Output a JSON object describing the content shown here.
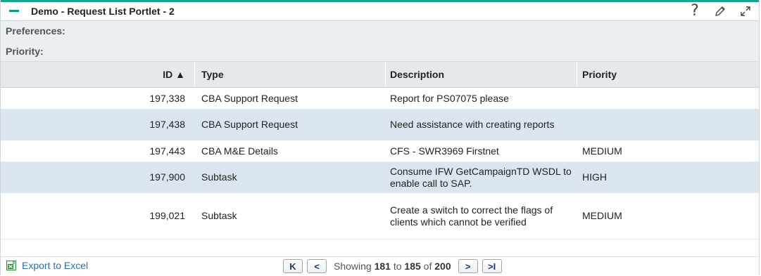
{
  "portlet": {
    "title": "Demo - Request List Portlet - 2"
  },
  "preferences": {
    "label": "Preferences:",
    "priority_label": "Priority:"
  },
  "table": {
    "columns": {
      "id": "ID ▲",
      "type": "Type",
      "description": "Description",
      "priority": "Priority"
    },
    "rows": [
      {
        "id": "197,338",
        "type": "CBA Support Request",
        "description": "Report for PS07075 please",
        "priority": ""
      },
      {
        "id": "197,438",
        "type": "CBA Support Request",
        "description": "Need assistance with creating reports",
        "priority": ""
      },
      {
        "id": "197,443",
        "type": "CBA M&E Details",
        "description": "CFS - SWR3969 Firstnet",
        "priority": "MEDIUM"
      },
      {
        "id": "197,900",
        "type": "Subtask",
        "description": "Consume IFW GetCampaignTD WSDL to enable call to SAP.",
        "priority": "HIGH"
      },
      {
        "id": "199,021",
        "type": "Subtask",
        "description": "Create a switch to correct the flags of clients which cannot be verified",
        "priority": "MEDIUM"
      }
    ]
  },
  "footer": {
    "export_label": "Export to Excel",
    "first_glyph": "K",
    "prev_glyph": "<",
    "next_glyph": ">",
    "last_glyph": ">I",
    "showing_prefix": "Showing",
    "range_start": "181",
    "to_word": "to",
    "range_end": "185",
    "of_word": "of",
    "total": "200"
  },
  "icons": {
    "collapse": "minus-icon",
    "help": "question-icon",
    "edit": "pencil-icon",
    "maximize": "expand-icon",
    "export": "excel-icon"
  },
  "colors": {
    "accent": "#15a78d",
    "row_alt": "#dbe5ef",
    "link": "#2d6fa8"
  }
}
